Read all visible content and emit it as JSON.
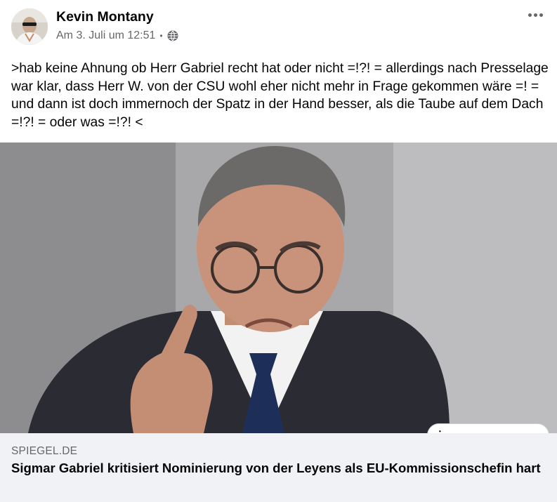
{
  "post": {
    "author": {
      "name": "Kevin Montany",
      "avatar_icon": "profile-photo"
    },
    "meta": {
      "timestamp": "Am 3. Juli um 12:51",
      "separator": "•",
      "audience_icon": "globe-icon"
    },
    "more_icon": "more-horizontal-icon",
    "text": ">hab keine Ahnung ob Herr Gabriel recht hat oder nicht =!?! = allerdings nach Presselage war klar, dass Herr W. von der CSU wohl eher nicht mehr in Frage gekommen wäre =! = und dann ist doch immernoch der Spatz in der Hand besser, als die Taube auf dem Dach =!?! = oder was =!?! <"
  },
  "link_preview": {
    "image_icon": "article-photo",
    "info_label": "i",
    "domain": "SPIEGEL.DE",
    "title": "Sigmar Gabriel kritisiert Nominierung von der Leyens als EU-Kommissionschefin hart"
  },
  "colors": {
    "secondary_text": "#65676b",
    "caption_background": "#f0f2f5",
    "primary_text": "#050505"
  }
}
